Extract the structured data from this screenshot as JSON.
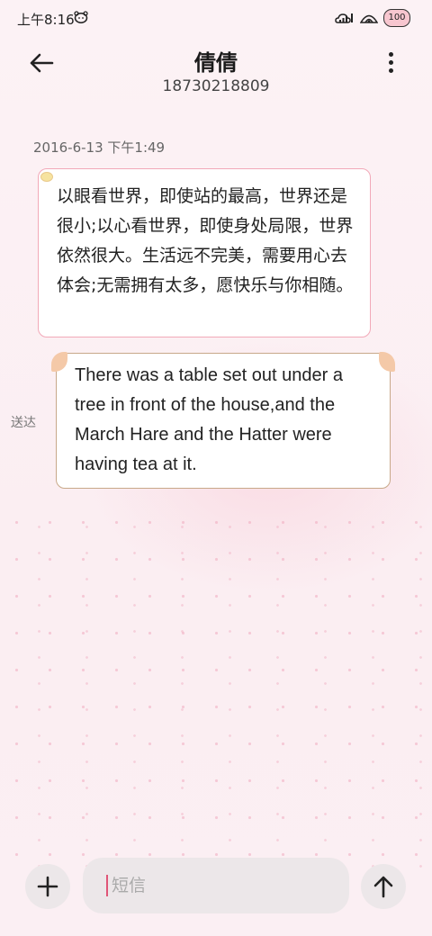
{
  "status_bar": {
    "time": "上午8:16",
    "battery": "100",
    "icons": [
      "mascot-icon",
      "cloud-signal-icon",
      "wifi-icon",
      "battery-icon"
    ]
  },
  "header": {
    "title": "倩倩",
    "subtitle": "18730218809",
    "back_icon": "arrow-left-icon",
    "more_icon": "more-vertical-icon"
  },
  "conversation": {
    "date": "2016-6-13 下午1:49",
    "messages": [
      {
        "direction": "incoming",
        "text": "以眼看世界，即使站的最高，世界还是很小;以心看世界，即使身处局限，世界依然很大。生活远不完美，需要用心去体会;无需拥有太多，愿快乐与你相随。"
      },
      {
        "direction": "outgoing",
        "text": "There was a table set out under a tree in front of the house,and the March Hare and the Hatter were having tea at it.",
        "status": "送达"
      }
    ]
  },
  "composer": {
    "placeholder": "短信",
    "value": "",
    "add_icon": "plus-icon",
    "send_icon": "arrow-up-icon"
  },
  "colors": {
    "background": "#fcf2f5",
    "incoming_border": "#f2a9b8",
    "outgoing_border": "#c8a889",
    "button_bg": "#ece7e9",
    "caret": "#e05577"
  }
}
